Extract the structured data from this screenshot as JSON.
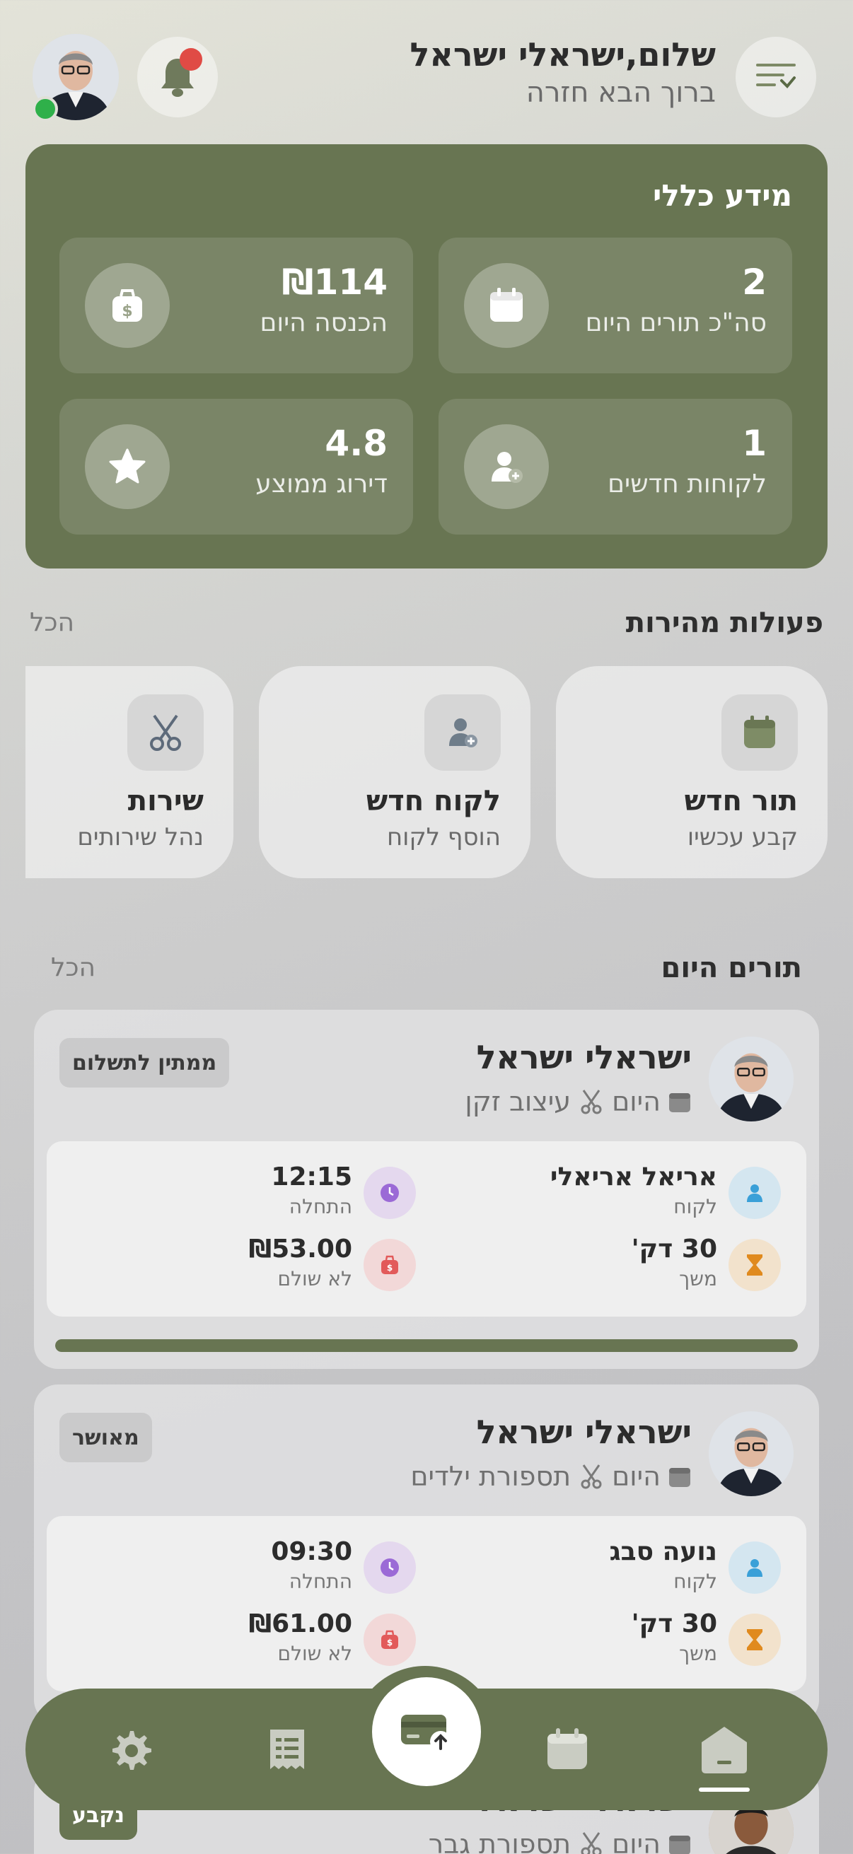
{
  "header": {
    "greeting": "שלום,ישראלי ישראל",
    "subtitle": "ברוך הבא חזרה"
  },
  "info": {
    "title": "מידע כללי",
    "stats": [
      {
        "value": "2",
        "label": "סה\"כ תורים היום",
        "icon": "calendar-icon"
      },
      {
        "value": "₪114",
        "label": "הכנסה היום",
        "icon": "money-bag-icon"
      },
      {
        "value": "1",
        "label": "לקוחות חדשים",
        "icon": "add-user-icon"
      },
      {
        "value": "4.8",
        "label": "דירוג ממוצע",
        "icon": "star-icon"
      }
    ]
  },
  "quick_actions": {
    "title": "פעולות מהירות",
    "all_label": "הכל",
    "items": [
      {
        "title": "תור חדש",
        "subtitle": "קבע עכשיו",
        "icon": "calendar-icon"
      },
      {
        "title": "לקוח חדש",
        "subtitle": "הוסף לקוח",
        "icon": "add-user-icon"
      },
      {
        "title": "שירות",
        "subtitle": "נהל שירותים",
        "icon": "scissors-icon"
      }
    ]
  },
  "appointments": {
    "title": "תורים היום",
    "all_label": "הכל",
    "items": [
      {
        "name": "ישראלי ישראל",
        "day": "היום",
        "service": "עיצוב זקן",
        "status": "ממתין לתשלום",
        "client": "אריאל אריאלי",
        "client_label": "לקוח",
        "start": "12:15",
        "start_label": "התחלה",
        "duration": "30 דק'",
        "duration_label": "משך",
        "price": "₪53.00",
        "price_label": "לא שולם",
        "progress": 1.0
      },
      {
        "name": "ישראלי ישראל",
        "day": "היום",
        "service": "תספורת ילדים",
        "status": "מאושר",
        "client": "נועה סבג",
        "client_label": "לקוח",
        "start": "09:30",
        "start_label": "התחלה",
        "duration": "30 דק'",
        "duration_label": "משך",
        "price": "₪61.00",
        "price_label": "לא שולם"
      },
      {
        "name": "ישראלי ישראל",
        "day": "היום",
        "service": "תספורת גבר",
        "status": "נקבע"
      }
    ]
  },
  "nav": {
    "items": [
      "settings-icon",
      "receipt-icon",
      "payment-card-icon",
      "calendar-icon",
      "home-icon"
    ],
    "active": "home-icon"
  },
  "colors": {
    "brand": "#687552",
    "notification": "#e04b45",
    "online": "#2fb04a"
  }
}
